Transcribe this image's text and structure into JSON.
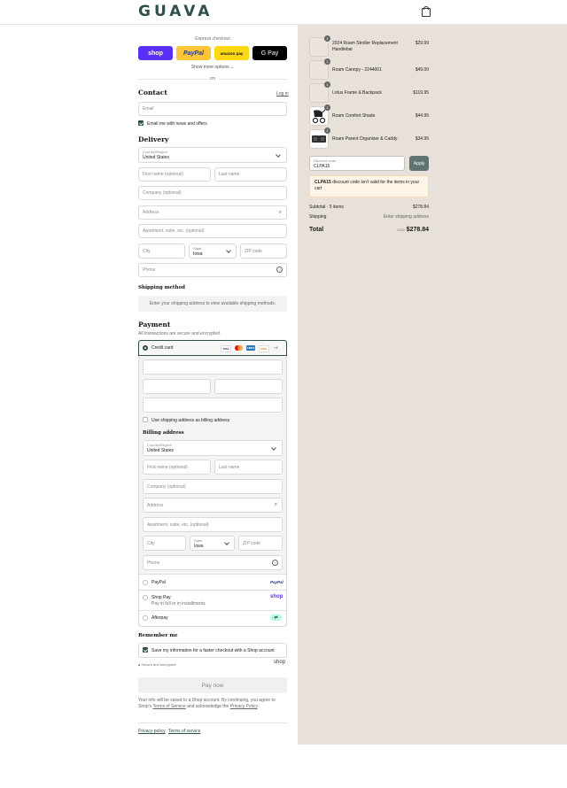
{
  "header": {
    "logo": "GUAVA",
    "cart_icon": "shopping-bag-icon"
  },
  "express": {
    "title": "Express checkout",
    "buttons": [
      {
        "label": "shop",
        "color": "#5a31f4"
      },
      {
        "label": "PayPal",
        "color": "#ffc439"
      },
      {
        "label": "amazon pay",
        "color": "#ffd814"
      },
      {
        "label": "G Pay",
        "color": "#000000"
      }
    ],
    "more_options": "Show more options",
    "or": "OR"
  },
  "contact": {
    "heading": "Contact",
    "login_link": "Log in",
    "email_placeholder": "Email",
    "news_checkbox": "Email me with news and offers"
  },
  "delivery": {
    "heading": "Delivery",
    "country_label": "Country/Region",
    "country_value": "United States",
    "first_name": "First name (optional)",
    "last_name": "Last name",
    "company": "Company (optional)",
    "address": "Address",
    "apartment": "Apartment, suite, etc. (optional)",
    "city": "City",
    "state_label": "State",
    "state_value": "Iowa",
    "zip": "ZIP code",
    "phone": "Phone"
  },
  "shipping": {
    "heading": "Shipping method",
    "notice": "Enter your shipping address to view available shipping methods."
  },
  "payment": {
    "heading": "Payment",
    "subtitle": "All transactions are secure and encrypted.",
    "credit_card": "Credit card",
    "cards": [
      "VISA",
      "MC",
      "AMEX",
      "DISC"
    ],
    "more_cards": "+4",
    "use_shipping": "Use shipping address as billing address",
    "billing_heading": "Billing address",
    "paypal": "PayPal",
    "shop_pay": "Shop Pay",
    "shop_pay_sub": "Pay in full or in installments",
    "afterpay": "Afterpay"
  },
  "remember": {
    "heading": "Remember me",
    "checkbox": "Save my information for a faster checkout with a Shop account",
    "secure": "Secure and encrypted",
    "shop_logo": "shop"
  },
  "pay_now": "Pay now",
  "legal": {
    "text1": "Your info will be saved to a Shop account. By continuing, you agree to Shop's",
    "terms": "Terms of Service",
    "and": "and acknowledge the",
    "privacy": "Privacy Policy",
    "period": "."
  },
  "footer": {
    "privacy": "Privacy policy",
    "terms": "Terms of service"
  },
  "cart": {
    "items": [
      {
        "qty": "1",
        "name": "2024 Roam Stroller Replacement Handlebar",
        "price": "$29.99"
      },
      {
        "qty": "1",
        "name": "Roam Canopy - 2244001",
        "price": "$49.00"
      },
      {
        "qty": "1",
        "name": "Lotus Frame & Backpack",
        "price": "$119.95"
      },
      {
        "qty": "1",
        "name": "Roam Comfort Shade",
        "price": "$44.95"
      },
      {
        "qty": "1",
        "name": "Roam Parent Organizer & Caddy",
        "price": "$34.95"
      }
    ],
    "discount_label": "Discount code",
    "discount_value": "CLPA15",
    "apply": "Apply",
    "error_code": "CLPA15",
    "error_text": "discount code isn't valid for the items in your cart",
    "subtotal_label": "Subtotal · 5 items",
    "subtotal_value": "$278.84",
    "shipping_label": "Shipping",
    "shipping_value": "Enter shipping address",
    "total_label": "Total",
    "currency": "USD",
    "total_value": "$278.84"
  }
}
